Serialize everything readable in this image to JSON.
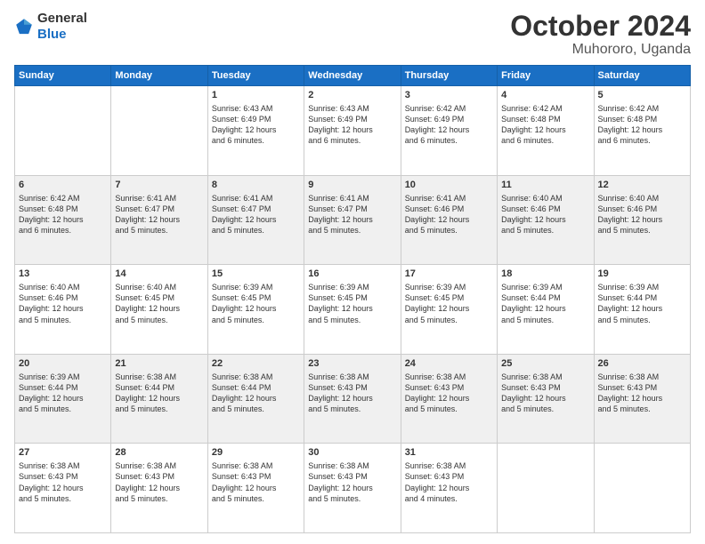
{
  "logo": {
    "general": "General",
    "blue": "Blue"
  },
  "title": {
    "month": "October 2024",
    "location": "Muhororo, Uganda"
  },
  "weekdays": [
    "Sunday",
    "Monday",
    "Tuesday",
    "Wednesday",
    "Thursday",
    "Friday",
    "Saturday"
  ],
  "weeks": [
    [
      {
        "day": "",
        "info": ""
      },
      {
        "day": "",
        "info": ""
      },
      {
        "day": "1",
        "info": "Sunrise: 6:43 AM\nSunset: 6:49 PM\nDaylight: 12 hours\nand 6 minutes."
      },
      {
        "day": "2",
        "info": "Sunrise: 6:43 AM\nSunset: 6:49 PM\nDaylight: 12 hours\nand 6 minutes."
      },
      {
        "day": "3",
        "info": "Sunrise: 6:42 AM\nSunset: 6:49 PM\nDaylight: 12 hours\nand 6 minutes."
      },
      {
        "day": "4",
        "info": "Sunrise: 6:42 AM\nSunset: 6:48 PM\nDaylight: 12 hours\nand 6 minutes."
      },
      {
        "day": "5",
        "info": "Sunrise: 6:42 AM\nSunset: 6:48 PM\nDaylight: 12 hours\nand 6 minutes."
      }
    ],
    [
      {
        "day": "6",
        "info": "Sunrise: 6:42 AM\nSunset: 6:48 PM\nDaylight: 12 hours\nand 6 minutes."
      },
      {
        "day": "7",
        "info": "Sunrise: 6:41 AM\nSunset: 6:47 PM\nDaylight: 12 hours\nand 5 minutes."
      },
      {
        "day": "8",
        "info": "Sunrise: 6:41 AM\nSunset: 6:47 PM\nDaylight: 12 hours\nand 5 minutes."
      },
      {
        "day": "9",
        "info": "Sunrise: 6:41 AM\nSunset: 6:47 PM\nDaylight: 12 hours\nand 5 minutes."
      },
      {
        "day": "10",
        "info": "Sunrise: 6:41 AM\nSunset: 6:46 PM\nDaylight: 12 hours\nand 5 minutes."
      },
      {
        "day": "11",
        "info": "Sunrise: 6:40 AM\nSunset: 6:46 PM\nDaylight: 12 hours\nand 5 minutes."
      },
      {
        "day": "12",
        "info": "Sunrise: 6:40 AM\nSunset: 6:46 PM\nDaylight: 12 hours\nand 5 minutes."
      }
    ],
    [
      {
        "day": "13",
        "info": "Sunrise: 6:40 AM\nSunset: 6:46 PM\nDaylight: 12 hours\nand 5 minutes."
      },
      {
        "day": "14",
        "info": "Sunrise: 6:40 AM\nSunset: 6:45 PM\nDaylight: 12 hours\nand 5 minutes."
      },
      {
        "day": "15",
        "info": "Sunrise: 6:39 AM\nSunset: 6:45 PM\nDaylight: 12 hours\nand 5 minutes."
      },
      {
        "day": "16",
        "info": "Sunrise: 6:39 AM\nSunset: 6:45 PM\nDaylight: 12 hours\nand 5 minutes."
      },
      {
        "day": "17",
        "info": "Sunrise: 6:39 AM\nSunset: 6:45 PM\nDaylight: 12 hours\nand 5 minutes."
      },
      {
        "day": "18",
        "info": "Sunrise: 6:39 AM\nSunset: 6:44 PM\nDaylight: 12 hours\nand 5 minutes."
      },
      {
        "day": "19",
        "info": "Sunrise: 6:39 AM\nSunset: 6:44 PM\nDaylight: 12 hours\nand 5 minutes."
      }
    ],
    [
      {
        "day": "20",
        "info": "Sunrise: 6:39 AM\nSunset: 6:44 PM\nDaylight: 12 hours\nand 5 minutes."
      },
      {
        "day": "21",
        "info": "Sunrise: 6:38 AM\nSunset: 6:44 PM\nDaylight: 12 hours\nand 5 minutes."
      },
      {
        "day": "22",
        "info": "Sunrise: 6:38 AM\nSunset: 6:44 PM\nDaylight: 12 hours\nand 5 minutes."
      },
      {
        "day": "23",
        "info": "Sunrise: 6:38 AM\nSunset: 6:43 PM\nDaylight: 12 hours\nand 5 minutes."
      },
      {
        "day": "24",
        "info": "Sunrise: 6:38 AM\nSunset: 6:43 PM\nDaylight: 12 hours\nand 5 minutes."
      },
      {
        "day": "25",
        "info": "Sunrise: 6:38 AM\nSunset: 6:43 PM\nDaylight: 12 hours\nand 5 minutes."
      },
      {
        "day": "26",
        "info": "Sunrise: 6:38 AM\nSunset: 6:43 PM\nDaylight: 12 hours\nand 5 minutes."
      }
    ],
    [
      {
        "day": "27",
        "info": "Sunrise: 6:38 AM\nSunset: 6:43 PM\nDaylight: 12 hours\nand 5 minutes."
      },
      {
        "day": "28",
        "info": "Sunrise: 6:38 AM\nSunset: 6:43 PM\nDaylight: 12 hours\nand 5 minutes."
      },
      {
        "day": "29",
        "info": "Sunrise: 6:38 AM\nSunset: 6:43 PM\nDaylight: 12 hours\nand 5 minutes."
      },
      {
        "day": "30",
        "info": "Sunrise: 6:38 AM\nSunset: 6:43 PM\nDaylight: 12 hours\nand 5 minutes."
      },
      {
        "day": "31",
        "info": "Sunrise: 6:38 AM\nSunset: 6:43 PM\nDaylight: 12 hours\nand 4 minutes."
      },
      {
        "day": "",
        "info": ""
      },
      {
        "day": "",
        "info": ""
      }
    ]
  ]
}
